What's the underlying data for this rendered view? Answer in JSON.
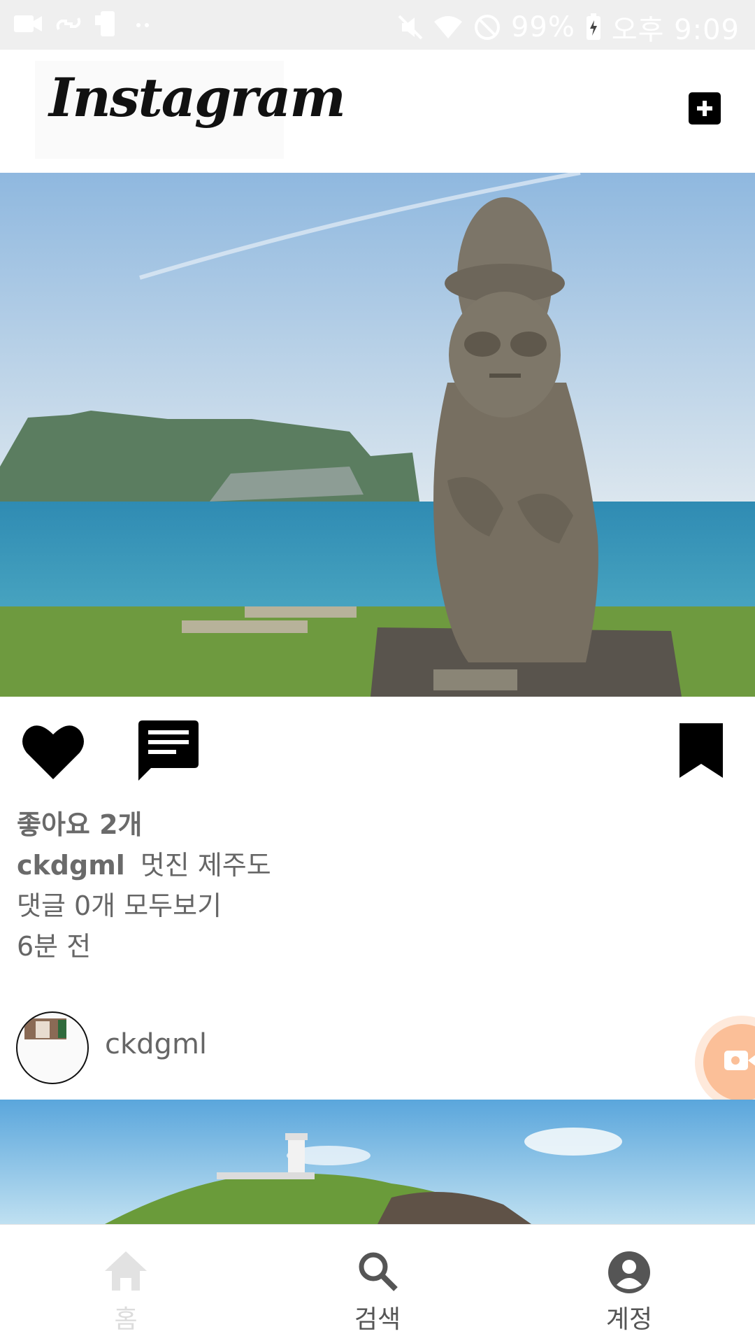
{
  "status_bar": {
    "battery": "99%",
    "time": "오후 9:09",
    "left_icons": [
      "video-camera-icon",
      "link-icon",
      "phone-icon",
      "more-dots-icon"
    ],
    "right_icons": [
      "mute-icon",
      "wifi-icon",
      "block-icon",
      "battery-icon"
    ]
  },
  "header": {
    "logo": "Instagram",
    "add_icon": "add-square-icon"
  },
  "post": {
    "like_icon": "heart-icon",
    "comment_icon": "comment-icon",
    "save_icon": "bookmark-icon",
    "likes": "좋아요 2개",
    "username": "ckdgml",
    "caption": "멋진 제주도",
    "comments_link": "댓글 0개 모두보기",
    "time_ago": "6분 전"
  },
  "next_post": {
    "username": "ckdgml"
  },
  "bottom_nav": {
    "items": [
      {
        "label": "홈",
        "icon": "home-icon"
      },
      {
        "label": "검색",
        "icon": "search-icon"
      },
      {
        "label": "계정",
        "icon": "account-icon"
      }
    ]
  },
  "colors": {
    "status_bar_bg": "#efefef",
    "text_gray": "#666666",
    "fab": "#fbbf98"
  }
}
